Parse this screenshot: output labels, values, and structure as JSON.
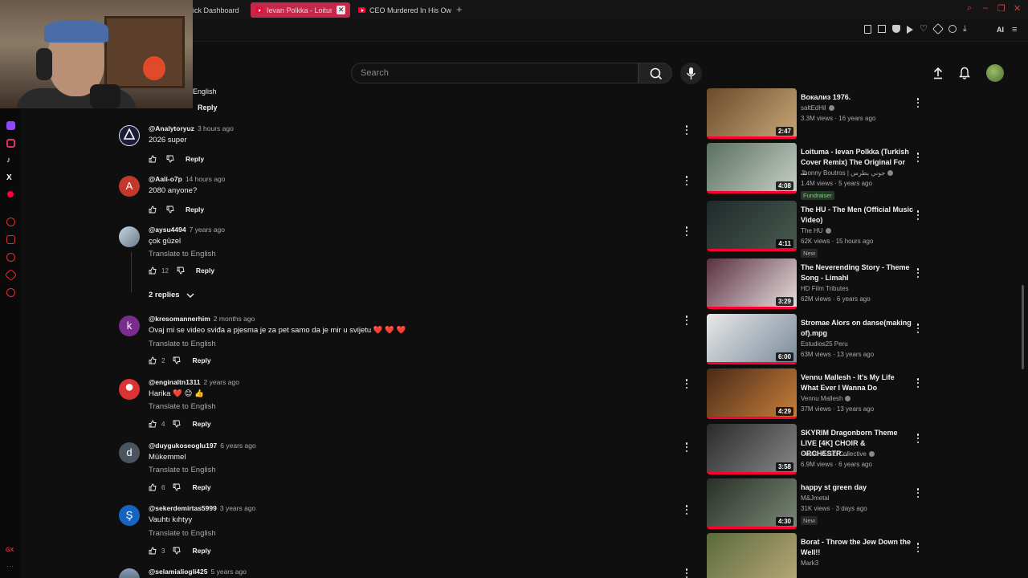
{
  "browser": {
    "tabs": [
      {
        "label": "Kick Dashboard"
      },
      {
        "label": "Ievan Polkka - Loitum"
      },
      {
        "label": "CEO Murdered In His Own"
      }
    ],
    "new_tab": "+",
    "ai_label": "AI"
  },
  "header": {
    "search_placeholder": "Search"
  },
  "comments": {
    "fragment_translate": "English",
    "fragment_reply": "Reply",
    "items": [
      {
        "avatar_letter": "",
        "avatar_color": "#2b2b5a",
        "user": "@Analytoryuz",
        "time": "3 hours ago",
        "text": "2026 super",
        "translate": "",
        "likes": "",
        "reply": "Reply"
      },
      {
        "avatar_letter": "A",
        "avatar_color": "#c0392b",
        "user": "@Aali-o7p",
        "time": "14 hours ago",
        "text": "2080 anyone?",
        "translate": "",
        "likes": "",
        "reply": "Reply"
      },
      {
        "avatar_letter": "",
        "avatar_color": "#8aa0b8",
        "user": "@aysu4494",
        "time": "7 years ago",
        "text": "çok güzel",
        "translate": "Translate to English",
        "likes": "12",
        "reply": "Reply"
      },
      {
        "avatar_letter": "k",
        "avatar_color": "#7b2d8e",
        "user": "@kresomannerhim",
        "time": "2 months ago",
        "text": "Ovaj mi se video sviđa a pjesma je za pet samo da je mir u svijetu ❤️ ❤️ ❤️",
        "translate": "Translate to English",
        "likes": "2",
        "reply": "Reply"
      },
      {
        "avatar_letter": "",
        "avatar_color": "#d33",
        "user": "@enginaltn1311",
        "time": "2 years ago",
        "text": "Harika ❤️ 😊 👍",
        "translate": "Translate to English",
        "likes": "4",
        "reply": "Reply"
      },
      {
        "avatar_letter": "d",
        "avatar_color": "#4a5560",
        "user": "@duygukoseoglu197",
        "time": "6 years ago",
        "text": "Mükemmel",
        "translate": "Translate to English",
        "likes": "6",
        "reply": "Reply"
      },
      {
        "avatar_letter": "Ş",
        "avatar_color": "#1565c0",
        "user": "@sekerdemirtas5999",
        "time": "3 years ago",
        "text": "Vauhtı kıhtyy",
        "translate": "Translate to English",
        "likes": "3",
        "reply": "Reply"
      },
      {
        "avatar_letter": "",
        "avatar_color": "#6a7a8a",
        "user": "@selamialiogli425",
        "time": "5 years ago",
        "text": "",
        "translate": "",
        "likes": "",
        "reply": ""
      }
    ],
    "replies_toggle": "2 replies"
  },
  "related": [
    {
      "title": "Вокализ 1976.",
      "channel": "saltEdHil",
      "verified": true,
      "meta": "3.3M views · 16 years ago",
      "duration": "2:47",
      "badge": "",
      "thumb": [
        "#6a4a2a",
        "#c8a878"
      ]
    },
    {
      "title": "Loituma - Ievan Polkka (Turkish Cover Remix) The Original For ...",
      "channel": "Jhonny Boutros | جوني بطرس",
      "verified": true,
      "meta": "1.4M views · 5 years ago",
      "duration": "4:08",
      "badge": "Fundraiser",
      "thumb": [
        "#5a7060",
        "#c8d0c8"
      ]
    },
    {
      "title": "The HU - The Men (Official Music Video)",
      "channel": "The HU",
      "verified": true,
      "meta": "62K views · 15 hours ago",
      "duration": "4:11",
      "badge": "New",
      "thumb": [
        "#1e2a2a",
        "#4a5a50"
      ]
    },
    {
      "title": "The Neverending Story - Theme Song - Limahl",
      "channel": "HD Film Tributes",
      "verified": false,
      "meta": "62M views · 6 years ago",
      "duration": "3:29",
      "badge": "",
      "thumb": [
        "#5a3040",
        "#e8e0e0"
      ]
    },
    {
      "title": "Stromae   Alors on danse(making of).mpg",
      "channel": "Estudios25 Peru",
      "verified": false,
      "meta": "63M views · 13 years ago",
      "duration": "6:00",
      "badge": "",
      "thumb": [
        "#e8e8e8",
        "#7a8a9a"
      ]
    },
    {
      "title": "Vennu Mallesh - It's My Life What Ever I Wanna Do",
      "channel": "Vennu Mallesh",
      "verified": true,
      "meta": "37M views · 13 years ago",
      "duration": "4:29",
      "badge": "",
      "thumb": [
        "#4a2a18",
        "#c8803a"
      ]
    },
    {
      "title": "SKYRIM Dragonborn Theme LIVE [4K] CHOIR & ORCHESTR...",
      "channel": "Game Music Collective",
      "verified": true,
      "meta": "6.9M views · 6 years ago",
      "duration": "3:58",
      "badge": "",
      "thumb": [
        "#2a2a2a",
        "#888888"
      ]
    },
    {
      "title": "happy st green day",
      "channel": "M&Jmetal",
      "verified": false,
      "meta": "31K views · 3 days ago",
      "duration": "4:30",
      "badge": "New",
      "thumb": [
        "#2a3028",
        "#7a8878"
      ]
    },
    {
      "title": "Borat - Throw the Jew Down the Well!!",
      "channel": "Mark3",
      "verified": false,
      "meta": "",
      "duration": "",
      "badge": "",
      "thumb": [
        "#5a6a3a",
        "#b8a878"
      ]
    }
  ],
  "colors": {
    "background": "#0f0f0f",
    "accent_red": "#ff0033",
    "tab_active": "#c4284a"
  }
}
